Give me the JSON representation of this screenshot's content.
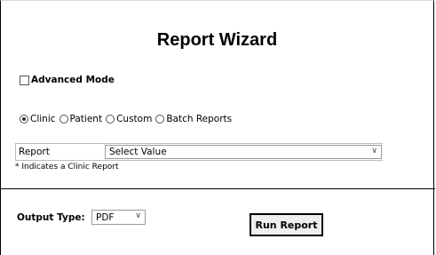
{
  "wizard": {
    "title": "Report Wizard"
  },
  "advanced_mode": {
    "label": "Advanced Mode",
    "checked": false
  },
  "report_types": {
    "selected": "Clinic",
    "options": [
      "Clinic",
      "Patient",
      "Custom",
      "Batch Reports"
    ]
  },
  "report": {
    "label": "Report",
    "selected_value": "Select Value",
    "note": "* Indicates a Clinic Report"
  },
  "output": {
    "label": "Output Type:",
    "selected_value": "PDF"
  },
  "actions": {
    "run_label": "Run Report"
  }
}
